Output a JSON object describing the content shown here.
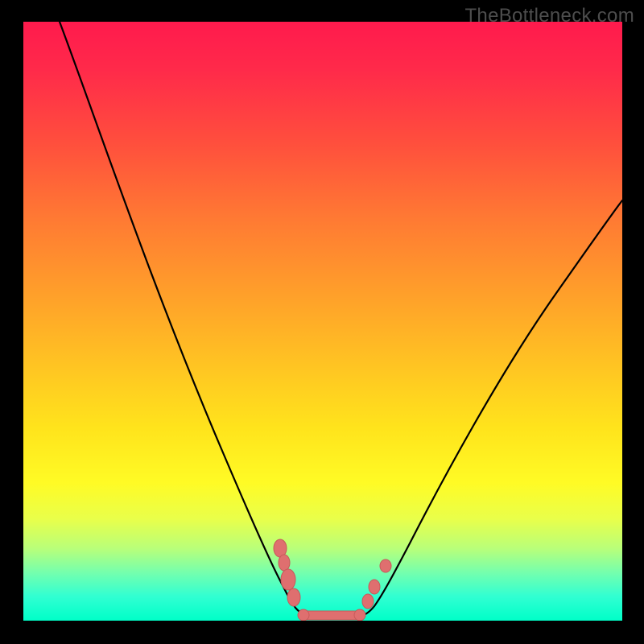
{
  "watermark": "TheBottleneck.com",
  "chart_data": {
    "type": "line",
    "title": "",
    "xlabel": "",
    "ylabel": "",
    "xlim": [
      0,
      100
    ],
    "ylim": [
      0,
      100
    ],
    "grid": false,
    "legend": false,
    "series": [
      {
        "name": "bottleneck-curve",
        "color": "#000000",
        "x": [
          6,
          10,
          14,
          18,
          22,
          26,
          30,
          34,
          38,
          42,
          44,
          46,
          48,
          50,
          52,
          54,
          56,
          58,
          62,
          66,
          70,
          74,
          78,
          82,
          86,
          90,
          94,
          98,
          100
        ],
        "y": [
          100,
          88,
          77,
          67,
          57,
          48,
          40,
          32,
          24,
          15,
          10,
          5,
          2,
          0,
          0,
          0,
          2,
          6,
          14,
          22,
          29,
          35,
          41,
          47,
          52,
          56,
          60,
          63,
          65
        ]
      }
    ],
    "markers": [
      {
        "name": "left-cluster",
        "color": "#e07070",
        "points": [
          {
            "x": 43,
            "y": 12
          },
          {
            "x": 44,
            "y": 8
          },
          {
            "x": 44.5,
            "y": 6
          },
          {
            "x": 45,
            "y": 3
          }
        ]
      },
      {
        "name": "bottom-band",
        "color": "#e07070",
        "points": [
          {
            "x": 47,
            "y": 0.5
          },
          {
            "x": 49,
            "y": 0.5
          },
          {
            "x": 51,
            "y": 0.5
          },
          {
            "x": 53,
            "y": 0.5
          },
          {
            "x": 55,
            "y": 0.5
          }
        ]
      },
      {
        "name": "right-cluster",
        "color": "#e07070",
        "points": [
          {
            "x": 57,
            "y": 4
          },
          {
            "x": 58,
            "y": 8
          },
          {
            "x": 60,
            "y": 11
          }
        ]
      }
    ],
    "gradient_stops": [
      {
        "pos": 0,
        "color": "#ff1a4d"
      },
      {
        "pos": 50,
        "color": "#ffc622"
      },
      {
        "pos": 80,
        "color": "#fffb25"
      },
      {
        "pos": 100,
        "color": "#00ffc8"
      }
    ]
  }
}
